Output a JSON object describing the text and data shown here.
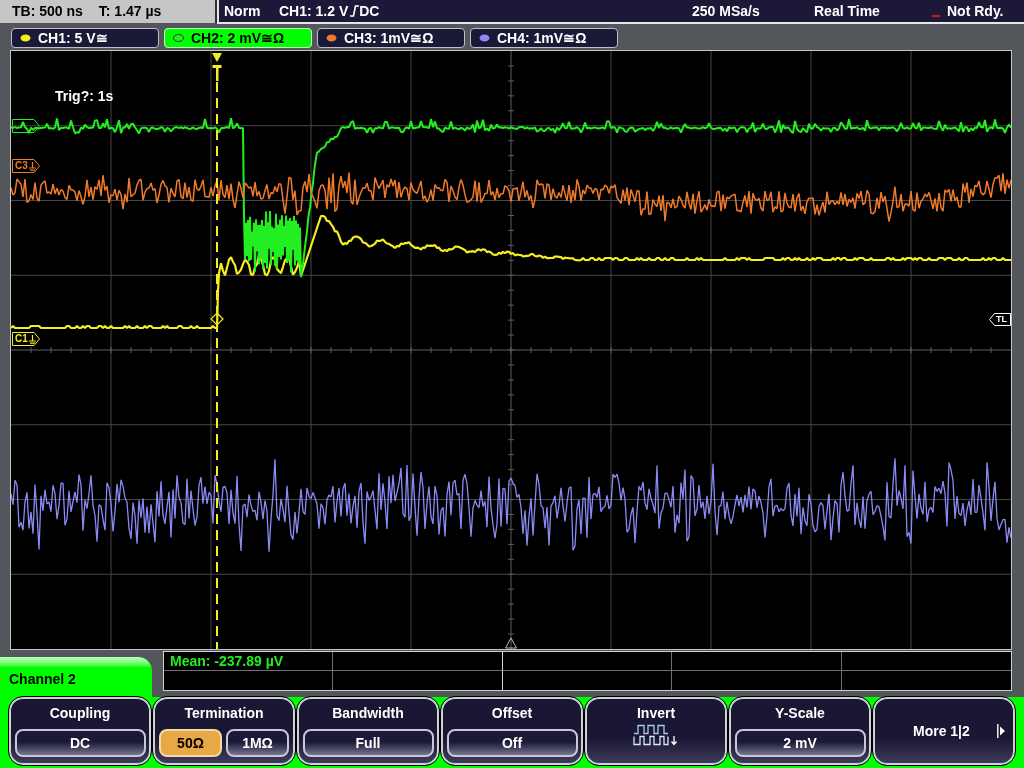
{
  "status_bar": {
    "timebase": "TB: 500 ns",
    "trigger_time": "T: 1.47 µs",
    "trigger_mode": "Norm",
    "trigger_source": "CH1: 1.2 V",
    "trigger_coupling": "DC",
    "sample_rate": "250 MSa/s",
    "acquisition": "Real Time",
    "state": "Not Rdy."
  },
  "channel_tabs": [
    {
      "label": "CH1: 5 V≅",
      "color": "#f5ee1e",
      "selected": false
    },
    {
      "label": "CH2: 2 mV≅Ω",
      "color": "#22ee22",
      "selected": true
    },
    {
      "label": "CH3: 1mV≅Ω",
      "color": "#f07a2a",
      "selected": false
    },
    {
      "label": "CH4: 1mV≅Ω",
      "color": "#8a8af5",
      "selected": false
    }
  ],
  "display": {
    "trigger_info": "Trig?: 1s",
    "channel_markers": [
      {
        "color": "#22ee22"
      },
      {
        "label": "C3",
        "color": "#f07a2a"
      },
      {
        "label": "C1",
        "color": "#f5ee1e"
      }
    ],
    "trigger_level_marker": "TL"
  },
  "menu": {
    "title": "Channel 2",
    "measurement": "Mean: -237.89 µV",
    "softkeys": [
      {
        "kind": "value",
        "label": "Coupling",
        "value": "DC"
      },
      {
        "kind": "options",
        "label": "Termination",
        "options": [
          {
            "label": "50Ω",
            "selected": true
          },
          {
            "label": "1MΩ",
            "selected": false
          }
        ]
      },
      {
        "kind": "value",
        "label": "Bandwidth",
        "value": "Full"
      },
      {
        "kind": "value",
        "label": "Offset",
        "value": "Off"
      },
      {
        "kind": "icon",
        "label": "Invert"
      },
      {
        "kind": "value",
        "label": "Y-Scale",
        "value": "2 mV"
      },
      {
        "kind": "next",
        "label": "More 1|2"
      }
    ]
  }
}
